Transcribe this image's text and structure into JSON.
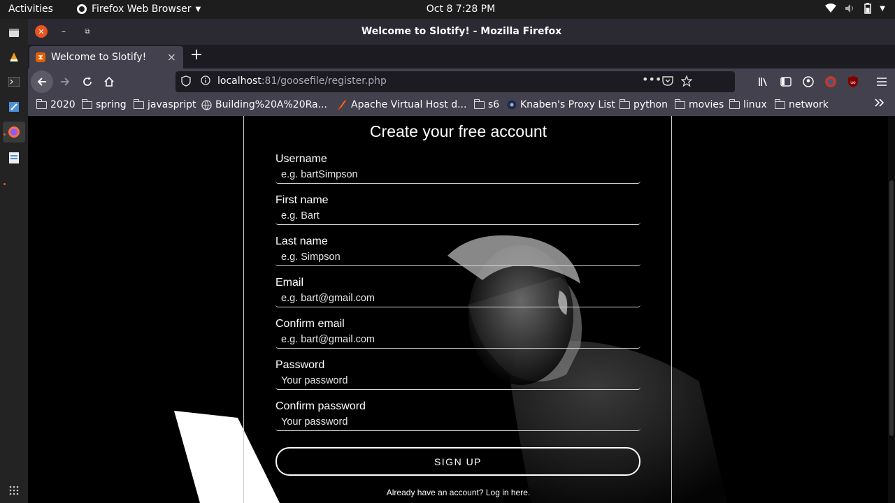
{
  "topbar": {
    "activities": "Activities",
    "app_name": "Firefox Web Browser",
    "clock": "Oct 8   7:28 PM"
  },
  "window": {
    "title": "Welcome to Slotify! - Mozilla Firefox"
  },
  "tab": {
    "title": "Welcome to Slotify!"
  },
  "urlbar": {
    "host": "localhost",
    "path": ":81/goosefile/register.php"
  },
  "bookmarks": [
    {
      "label": "2020",
      "icon": "folder-icon"
    },
    {
      "label": "spring",
      "icon": "folder-icon"
    },
    {
      "label": "javaspript",
      "icon": "folder-icon"
    },
    {
      "label": "Building%20A%20Ra...",
      "icon": "globe-icon"
    },
    {
      "label": "Apache Virtual Host d...",
      "icon": "feather-icon"
    },
    {
      "label": "s6",
      "icon": "folder-icon"
    },
    {
      "label": "Knaben's Proxy List",
      "icon": "site-icon"
    },
    {
      "label": "python",
      "icon": "folder-icon"
    },
    {
      "label": "movies",
      "icon": "folder-icon"
    },
    {
      "label": "linux",
      "icon": "folder-icon"
    },
    {
      "label": "network",
      "icon": "folder-icon"
    }
  ],
  "form": {
    "heading": "Create your free account",
    "fields": [
      {
        "label": "Username",
        "placeholder": "e.g. bartSimpson"
      },
      {
        "label": "First name",
        "placeholder": "e.g. Bart"
      },
      {
        "label": "Last name",
        "placeholder": "e.g. Simpson"
      },
      {
        "label": "Email",
        "placeholder": "e.g. bart@gmail.com"
      },
      {
        "label": "Confirm email",
        "placeholder": "e.g. bart@gmail.com"
      },
      {
        "label": "Password",
        "placeholder": "Your password"
      },
      {
        "label": "Confirm password",
        "placeholder": "Your password"
      }
    ],
    "submit_label": "SIGN UP",
    "login_text": "Already have an account? Log in here."
  },
  "colors": {
    "accent": "#e95420",
    "page_bg": "#000000",
    "toolbar_bg": "#42414d",
    "titlebar_bg": "#2b2a33"
  }
}
